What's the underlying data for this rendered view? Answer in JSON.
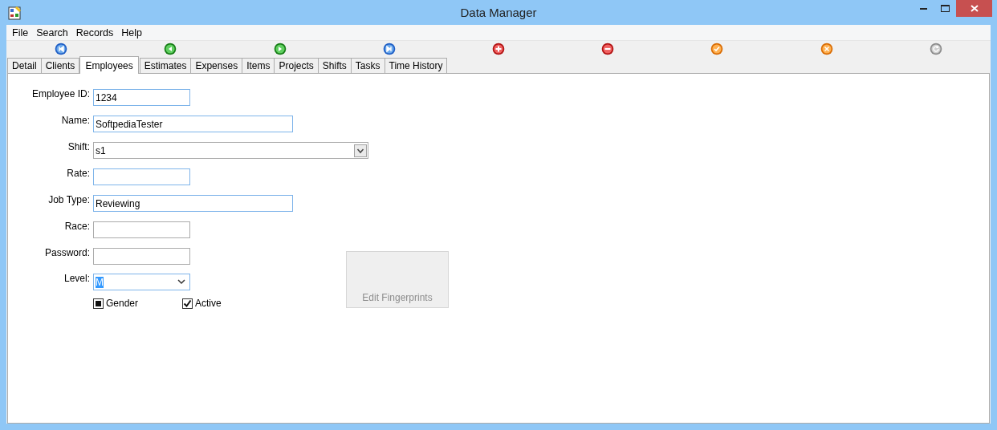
{
  "window": {
    "title": "Data Manager"
  },
  "menu": [
    "File",
    "Search",
    "Records",
    "Help"
  ],
  "toolbar": [
    {
      "kind": "first",
      "disabled": false
    },
    {
      "kind": "previous",
      "disabled": false
    },
    {
      "kind": "next",
      "disabled": false
    },
    {
      "kind": "last",
      "disabled": false
    },
    {
      "kind": "add",
      "disabled": false
    },
    {
      "kind": "delete",
      "disabled": false
    },
    {
      "kind": "save",
      "disabled": false
    },
    {
      "kind": "cancel",
      "disabled": false
    },
    {
      "kind": "refresh",
      "disabled": true
    }
  ],
  "tabs": [
    {
      "label": "Detail",
      "selected": false
    },
    {
      "label": "Clients",
      "selected": false
    },
    {
      "label": "Employees",
      "selected": true
    },
    {
      "label": "Estimates",
      "selected": false
    },
    {
      "label": "Expenses",
      "selected": false
    },
    {
      "label": "Items",
      "selected": false
    },
    {
      "label": "Projects",
      "selected": false
    },
    {
      "label": "Shifts",
      "selected": false
    },
    {
      "label": "Tasks",
      "selected": false
    },
    {
      "label": "Time History",
      "selected": false
    }
  ],
  "form": {
    "fields": [
      {
        "kind": "text",
        "label": "Employee ID:",
        "value": "1234",
        "highlighted": true
      },
      {
        "kind": "text",
        "label": "Name:",
        "value": "SoftpediaTester",
        "highlighted": true
      },
      {
        "kind": "select",
        "label": "Shift:",
        "value": "s1",
        "highlighted": false
      },
      {
        "kind": "text",
        "label": "Rate:",
        "highlighted": true
      },
      {
        "kind": "text",
        "label": "Job Type:",
        "value": "Reviewing",
        "highlighted": true
      },
      {
        "kind": "text",
        "label": "Race:",
        "highlighted": false
      },
      {
        "kind": "text",
        "label": "Password:",
        "highlighted": false
      },
      {
        "kind": "combo",
        "label": "Level:",
        "value": "M",
        "highlighted": true,
        "value_selected": true
      }
    ],
    "checkboxes": [
      {
        "label": "Gender",
        "indeterminate": true
      },
      {
        "label": "Active",
        "checked": true
      }
    ],
    "button": {
      "label": "Edit Fingerprints",
      "disabled": true
    }
  }
}
